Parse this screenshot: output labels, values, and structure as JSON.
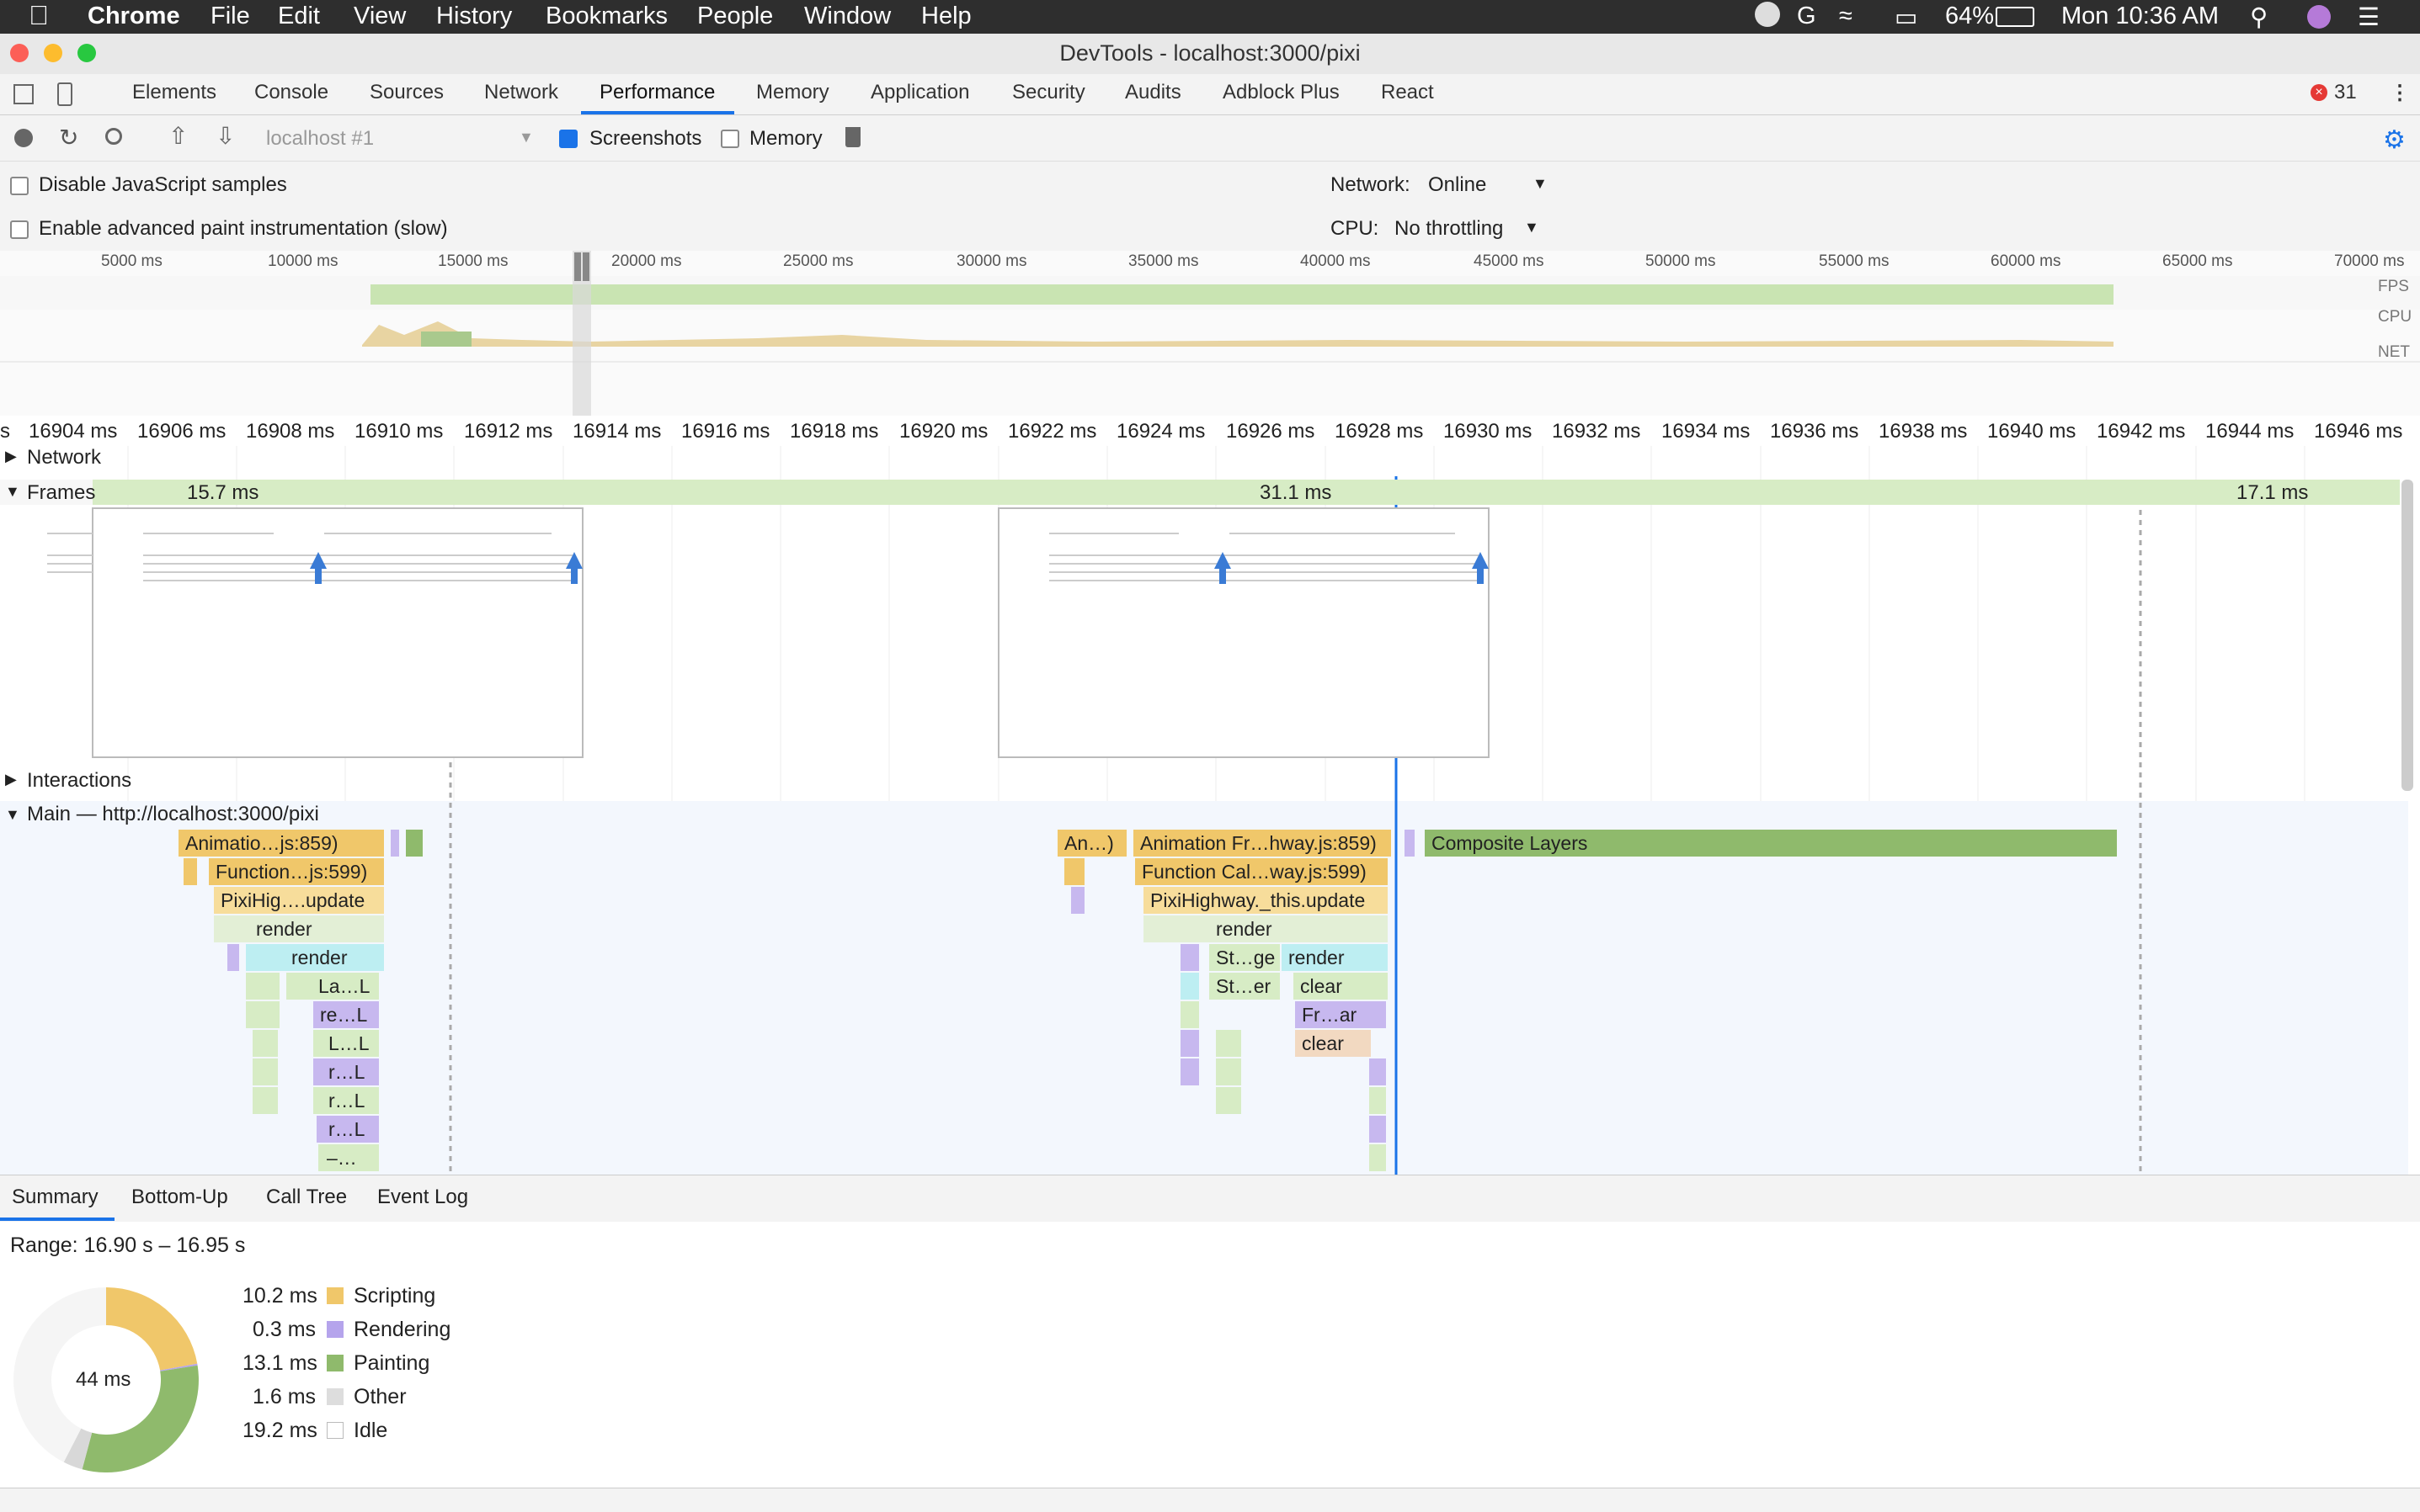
{
  "menubar": {
    "app": "Chrome",
    "items": [
      "File",
      "Edit",
      "View",
      "History",
      "Bookmarks",
      "People",
      "Window",
      "Help"
    ],
    "battery": "64%",
    "clock": "Mon 10:36 AM"
  },
  "window": {
    "title": "DevTools - localhost:3000/pixi"
  },
  "tabs": [
    "Elements",
    "Console",
    "Sources",
    "Network",
    "Performance",
    "Memory",
    "Application",
    "Security",
    "Audits",
    "Adblock Plus",
    "React"
  ],
  "active_tab": "Performance",
  "error_count": "31",
  "toolbar": {
    "profile_select": "localhost #1",
    "screenshots_label": "Screenshots",
    "screenshots_checked": true,
    "memory_label": "Memory",
    "memory_checked": false
  },
  "settings": {
    "disable_js_samples": "Disable JavaScript samples",
    "advanced_paint": "Enable advanced paint instrumentation (slow)",
    "network_label": "Network:",
    "network_value": "Online",
    "cpu_label": "CPU:",
    "cpu_value": "No throttling"
  },
  "overview": {
    "ticks": [
      "5000 ms",
      "10000 ms",
      "15000 ms",
      "20000 ms",
      "25000 ms",
      "30000 ms",
      "35000 ms",
      "40000 ms",
      "45000 ms",
      "50000 ms",
      "55000 ms",
      "60000 ms",
      "65000 ms",
      "70000 ms"
    ],
    "labels": [
      "FPS",
      "CPU",
      "NET"
    ]
  },
  "ruler": {
    "ticks": [
      "s",
      "16904 ms",
      "16906 ms",
      "16908 ms",
      "16910 ms",
      "16912 ms",
      "16914 ms",
      "16916 ms",
      "16918 ms",
      "16920 ms",
      "16922 ms",
      "16924 ms",
      "16926 ms",
      "16928 ms",
      "16930 ms",
      "16932 ms",
      "16934 ms",
      "16936 ms",
      "16938 ms",
      "16940 ms",
      "16942 ms",
      "16944 ms",
      "16946 ms"
    ]
  },
  "tracks": {
    "network": "Network",
    "frames": "Frames",
    "frame_durations": [
      "15.7 ms",
      "31.1 ms",
      "17.1 ms"
    ],
    "interactions": "Interactions",
    "main": "Main — http://localhost:3000/pixi"
  },
  "flame": {
    "left": [
      "Animatio…js:859)",
      "Function…js:599)",
      "PixiHig….update",
      "render",
      "render",
      "La…L",
      "re…L",
      "L…L",
      "r…L",
      "r…L",
      "r…L",
      "–…"
    ],
    "right": [
      "An…)",
      "Animation Fr…hway.js:859)",
      "Function Cal…way.js:599)",
      "PixiHighway._this.update",
      "render",
      "St…ge",
      "render",
      "St…er",
      "clear",
      "Fr…ar",
      "clear",
      "Composite Layers"
    ]
  },
  "bottom_tabs": [
    "Summary",
    "Bottom-Up",
    "Call Tree",
    "Event Log"
  ],
  "summary": {
    "range": "Range: 16.90 s – 16.95 s",
    "total": "44 ms",
    "rows": [
      {
        "value": "10.2 ms",
        "label": "Scripting",
        "color": "#f0c76a"
      },
      {
        "value": "0.3 ms",
        "label": "Rendering",
        "color": "#b5a4ec"
      },
      {
        "value": "13.1 ms",
        "label": "Painting",
        "color": "#8fba6c"
      },
      {
        "value": "1.6 ms",
        "label": "Other",
        "color": "#dddddd"
      },
      {
        "value": "19.2 ms",
        "label": "Idle",
        "color": "#ffffff"
      }
    ]
  }
}
